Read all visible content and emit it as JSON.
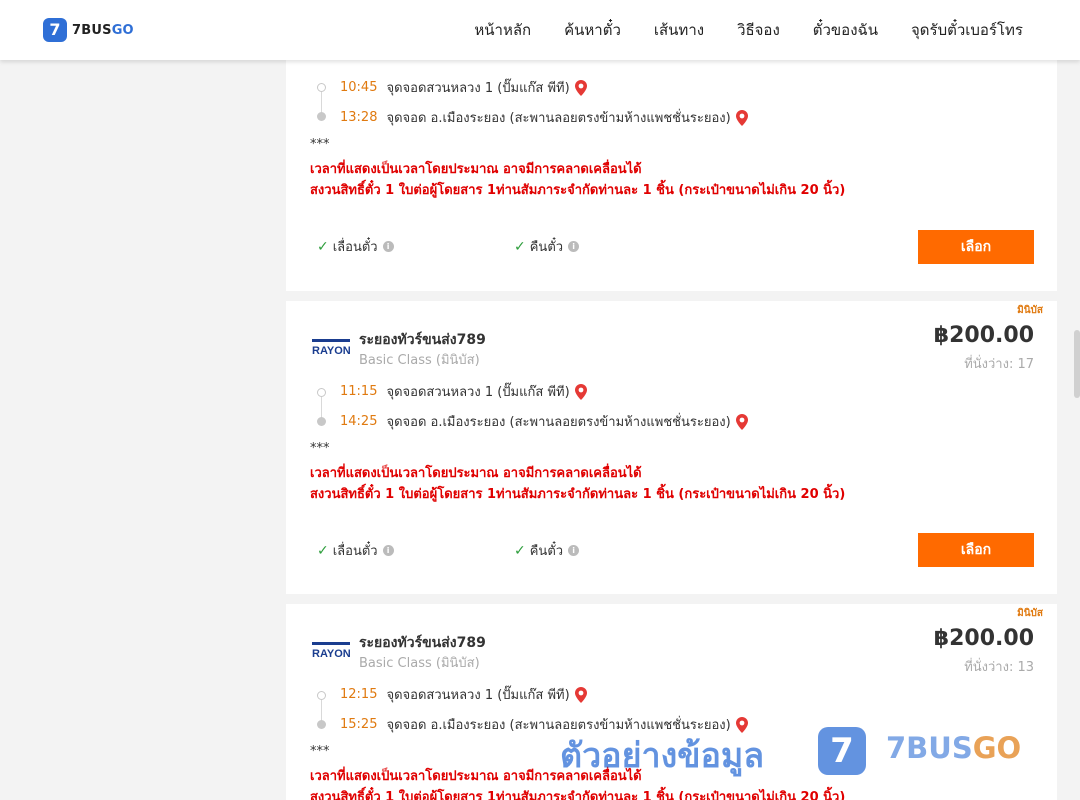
{
  "header": {
    "logo_badge": "7",
    "logo_text_main": "7BUS",
    "logo_text_go": "GO",
    "nav": [
      "หน้าหลัก",
      "ค้นหาตั๋ว",
      "เส้นทาง",
      "วิธีจอง",
      "ตั๋วของฉัน",
      "จุดรับตั๋วเบอร์โทร"
    ]
  },
  "cards": [
    {
      "departure_time": "10:45",
      "departure_stop": "จุดจอดสวนหลวง 1 (ปั๊มแก๊ส พีที)",
      "arrival_time": "13:28",
      "arrival_stop": "จุดจอด อ.เมืองระยอง (สะพานลอยตรงข้ามห้างแพชชั่นระยอง)",
      "stars": "***",
      "warn1": "เวลาที่แสดงเป็นเวลาโดยประมาณ อาจมีการคลาดเคลื่อนได้",
      "warn2": "สงวนสิทธิ์ตั๋ว 1 ใบต่อผู้โดยสาร 1ท่านสัมภาระจำกัดท่านละ 1 ชิ้น (กระเป๋าขนาดไม่เกิน 20 นิ้ว)",
      "feature1": "เลื่อนตั๋ว",
      "feature2": "คืนตั๋ว",
      "select_label": "เลือก"
    },
    {
      "tag": "มินิบัส",
      "operator_logo": "RAYONG",
      "operator_name": "ระยองทัวร์ขนส่ง789",
      "bus_class": "Basic Class (มินิบัส)",
      "price": "฿200.00",
      "seats": "ที่นั่งว่าง: 17",
      "departure_time": "11:15",
      "departure_stop": "จุดจอดสวนหลวง 1 (ปั๊มแก๊ส พีที)",
      "arrival_time": "14:25",
      "arrival_stop": "จุดจอด อ.เมืองระยอง (สะพานลอยตรงข้ามห้างแพชชั่นระยอง)",
      "stars": "***",
      "warn1": "เวลาที่แสดงเป็นเวลาโดยประมาณ อาจมีการคลาดเคลื่อนได้",
      "warn2": "สงวนสิทธิ์ตั๋ว 1 ใบต่อผู้โดยสาร 1ท่านสัมภาระจำกัดท่านละ 1 ชิ้น (กระเป๋าขนาดไม่เกิน 20 นิ้ว)",
      "feature1": "เลื่อนตั๋ว",
      "feature2": "คืนตั๋ว",
      "select_label": "เลือก"
    },
    {
      "tag": "มินิบัส",
      "operator_logo": "RAYONG",
      "operator_name": "ระยองทัวร์ขนส่ง789",
      "bus_class": "Basic Class (มินิบัส)",
      "price": "฿200.00",
      "seats": "ที่นั่งว่าง: 13",
      "departure_time": "12:15",
      "departure_stop": "จุดจอดสวนหลวง 1 (ปั๊มแก๊ส พีที)",
      "arrival_time": "15:25",
      "arrival_stop": "จุดจอด อ.เมืองระยอง (สะพานลอยตรงข้ามห้างแพชชั่นระยอง)",
      "stars": "***",
      "warn1": "เวลาที่แสดงเป็นเวลาโดยประมาณ อาจมีการคลาดเคลื่อนได้",
      "warn2": "สงวนสิทธิ์ตั๋ว 1 ใบต่อผู้โดยสาร 1ท่านสัมภาระจำกัดท่านละ 1 ชิ้น (กระเป๋าขนาดไม่เกิน 20 นิ้ว)"
    }
  ],
  "watermark": {
    "text": "ตัวอย่างข้อมูล",
    "badge": "7",
    "brand_main": "7BUS",
    "brand_go": "GO"
  },
  "colors": {
    "accent": "#ff6a00",
    "time": "#e07a10",
    "warning": "#e00000",
    "brand_blue": "#2f6fd6",
    "check": "#2e9e3c"
  }
}
